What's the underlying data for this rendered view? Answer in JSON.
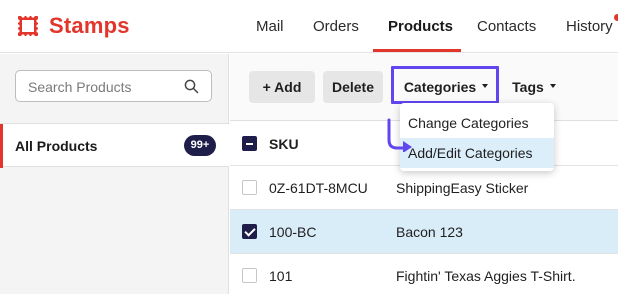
{
  "app": {
    "brand": "Stamps",
    "brand_color": "#e2352b"
  },
  "nav": {
    "items": [
      {
        "label": "Mail"
      },
      {
        "label": "Orders"
      },
      {
        "label": "Products",
        "active": true
      },
      {
        "label": "Contacts"
      },
      {
        "label": "History"
      }
    ]
  },
  "sidebar": {
    "search_placeholder": "Search Products",
    "all_products_label": "All Products",
    "all_products_count": "99+"
  },
  "toolbar": {
    "add_label": "+ Add",
    "delete_label": "Delete",
    "categories_label": "Categories",
    "tags_label": "Tags"
  },
  "categories_menu": {
    "items": [
      {
        "label": "Change Categories"
      },
      {
        "label": "Add/Edit Categories",
        "hovered": true
      }
    ]
  },
  "table": {
    "header": {
      "sku": "SKU"
    },
    "rows": [
      {
        "sku": "0Z-61DT-8MCU",
        "name": "ShippingEasy Sticker",
        "checked": false
      },
      {
        "sku": "100-BC",
        "name": "Bacon 123",
        "checked": true
      },
      {
        "sku": "101",
        "name": "Fightin' Texas Aggies T-Shirt.",
        "checked": false
      }
    ]
  },
  "colors": {
    "accent": "#e2352b",
    "badge": "#1f1d4a",
    "highlight_box": "#6146f0",
    "selected_row": "#d9edf9"
  }
}
